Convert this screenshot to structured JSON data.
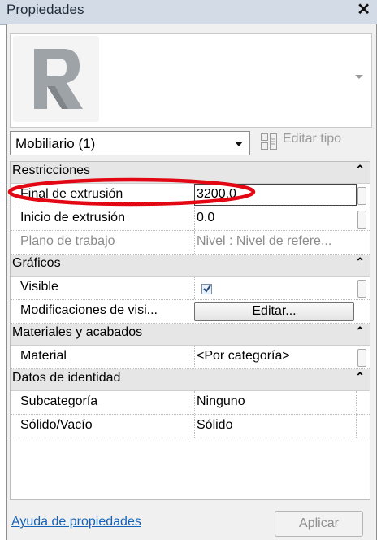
{
  "window": {
    "title": "Propiedades",
    "close_glyph": "✕"
  },
  "palette": {
    "thumbnail_icon": "revit-r-icon"
  },
  "type_selector": {
    "selected": "Mobiliario (1)",
    "edit_type_label": "Editar tipo"
  },
  "sections": [
    {
      "label": "Restricciones",
      "rows": [
        {
          "label": "Final de extrusión",
          "value": "3200.0",
          "dim": false
        },
        {
          "label": "Inicio de extrusión",
          "value": "0.0",
          "dim": false
        },
        {
          "label": "Plano de trabajo",
          "value": "Nivel : Nivel de refere...",
          "dim": true
        }
      ]
    },
    {
      "label": "Gráficos",
      "rows": [
        {
          "label": "Visible",
          "checked": true
        },
        {
          "label": "Modificaciones de visi...",
          "button": "Editar..."
        }
      ]
    },
    {
      "label": "Materiales y acabados",
      "rows": [
        {
          "label": "Material",
          "value": "<Por categoría>"
        }
      ]
    },
    {
      "label": "Datos de identidad",
      "rows": [
        {
          "label": "Subcategoría",
          "value": "Ninguno"
        },
        {
          "label": "Sólido/Vacío",
          "value": "Sólido"
        }
      ]
    }
  ],
  "footer": {
    "help_link": "Ayuda de propiedades",
    "apply_label": "Aplicar"
  },
  "colors": {
    "annotation": "#e30613",
    "link": "#1463b8",
    "section_bg": "#e6e6e6"
  }
}
